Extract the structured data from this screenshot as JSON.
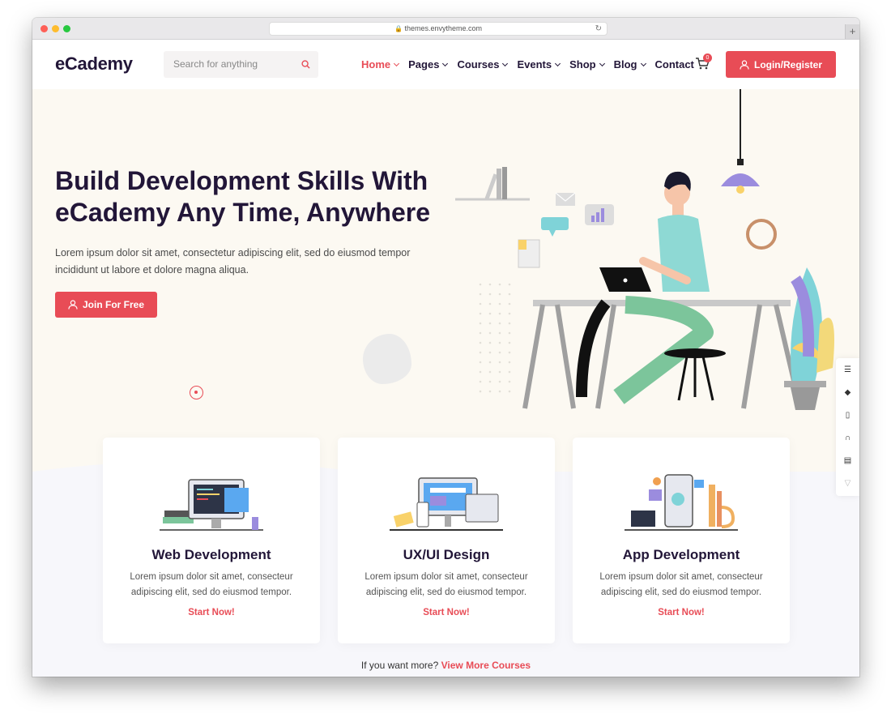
{
  "browser": {
    "url": "themes.envytheme.com"
  },
  "header": {
    "logo": "eCademy",
    "search_placeholder": "Search for anything",
    "menu": [
      {
        "label": "Home",
        "dropdown": true,
        "active": true
      },
      {
        "label": "Pages",
        "dropdown": true
      },
      {
        "label": "Courses",
        "dropdown": true
      },
      {
        "label": "Events",
        "dropdown": true
      },
      {
        "label": "Shop",
        "dropdown": true
      },
      {
        "label": "Blog",
        "dropdown": true
      },
      {
        "label": "Contact",
        "dropdown": false
      }
    ],
    "cart_count": "0",
    "login_label": "Login/Register"
  },
  "hero": {
    "title_line1": "Build Development Skills With",
    "title_line2": "eCademy Any Time, Anywhere",
    "description_line1": "Lorem ipsum dolor sit amet, consectetur adipiscing elit, sed do eiusmod tempor",
    "description_line2": "incididunt ut labore et dolore magna aliqua.",
    "cta_label": "Join For Free"
  },
  "cards": [
    {
      "title": "Web Development",
      "desc_line1": "Lorem ipsum dolor sit amet, consecteur",
      "desc_line2": "adipiscing elit, sed do eiusmod tempor.",
      "link": "Start Now!"
    },
    {
      "title": "UX/UI Design",
      "desc_line1": "Lorem ipsum dolor sit amet, consecteur",
      "desc_line2": "adipiscing elit, sed do eiusmod tempor.",
      "link": "Start Now!"
    },
    {
      "title": "App Development",
      "desc_line1": "Lorem ipsum dolor sit amet, consecteur",
      "desc_line2": "adipiscing elit, sed do eiusmod tempor.",
      "link": "Start Now!"
    }
  ],
  "more": {
    "prefix": "If you want more?",
    "link": "View More Courses"
  },
  "colors": {
    "accent": "#e84c56",
    "dark": "#221638",
    "hero_bg": "#fcf9f2"
  },
  "side_tools": [
    "list-icon",
    "layers-icon",
    "book-icon",
    "headset-icon",
    "note-icon",
    "cart-icon"
  ]
}
